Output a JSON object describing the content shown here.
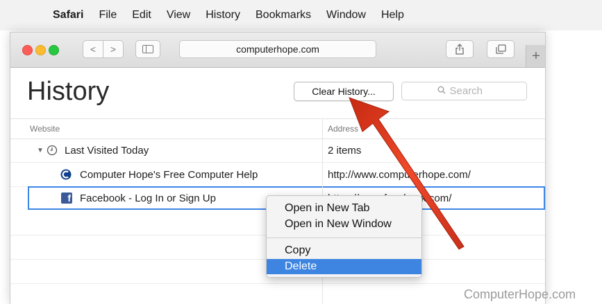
{
  "menubar": {
    "apple_icon": "apple-logo-icon",
    "items": [
      "Safari",
      "File",
      "Edit",
      "View",
      "History",
      "Bookmarks",
      "Window",
      "Help"
    ]
  },
  "toolbar": {
    "back_label": "<",
    "forward_label": ">",
    "address": "computerhope.com",
    "new_tab_label": "+"
  },
  "history": {
    "title": "History",
    "clear_button": "Clear History...",
    "search_placeholder": "Search",
    "columns": {
      "website": "Website",
      "address": "Address"
    },
    "group": {
      "label": "Last Visited Today",
      "count": "2 items"
    },
    "rows": [
      {
        "name": "Computer Hope's Free Computer Help",
        "url": "http://www.computerhope.com/"
      },
      {
        "name": "Facebook - Log In or Sign Up",
        "url": "https://www.facebook.com/"
      }
    ]
  },
  "context_menu": {
    "items": [
      "Open in New Tab",
      "Open in New Window",
      "Copy",
      "Delete"
    ],
    "active_index": 3
  },
  "colors": {
    "accent": "#3d85e0",
    "arrow": "#e23a1f"
  },
  "watermark": "ComputerHope.com"
}
